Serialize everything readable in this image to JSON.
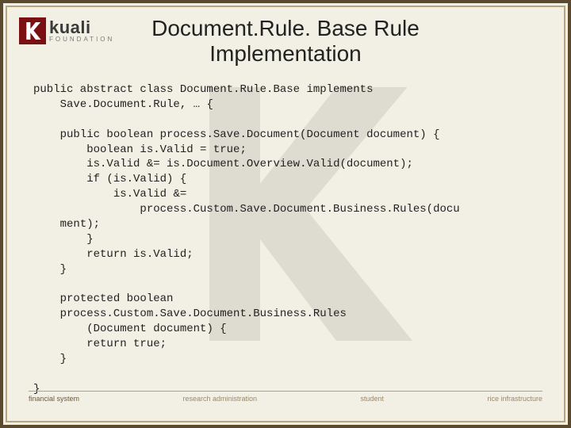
{
  "logo": {
    "brand": "kuali",
    "sub": "FOUNDATION"
  },
  "title": {
    "line1": "Document.Rule. Base Rule",
    "line2": "Implementation"
  },
  "code": "public abstract class Document.Rule.Base implements\n    Save.Document.Rule, … {\n\n    public boolean process.Save.Document(Document document) {\n        boolean is.Valid = true;\n        is.Valid &= is.Document.Overview.Valid(document);\n        if (is.Valid) {\n            is.Valid &=\n                process.Custom.Save.Document.Business.Rules(docu\n    ment);\n        }\n        return is.Valid;\n    }\n\n    protected boolean\n    process.Custom.Save.Document.Business.Rules\n        (Document document) {\n        return true;\n    }\n\n}",
  "footer": {
    "c1": "financial system",
    "c2": "research administration",
    "c3": "student",
    "c4": "rice infrastructure"
  }
}
